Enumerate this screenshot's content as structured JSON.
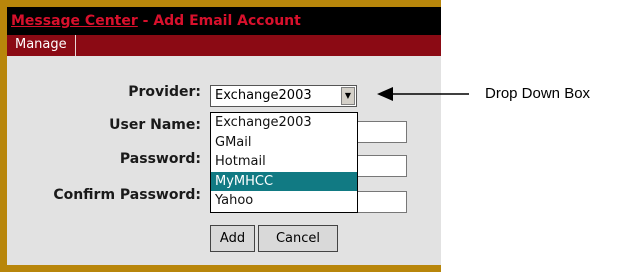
{
  "window": {
    "title_link": "Message Center",
    "title_rest": " - Add Email Account"
  },
  "menu": {
    "items": [
      {
        "label": "Manage"
      }
    ]
  },
  "form": {
    "provider_label": "Provider:",
    "username_label": "User Name:",
    "password_label": "Password:",
    "confirm_label": "Confirm Password:",
    "provider_selected": "Exchange2003",
    "provider_options": [
      "Exchange2003",
      "GMail",
      "Hotmail",
      "MyMHCC",
      "Yahoo"
    ],
    "highlighted_option": "MyMHCC",
    "username_value": "",
    "password_value": "",
    "confirm_value": ""
  },
  "buttons": {
    "add_label": "Add",
    "cancel_label": "Cancel"
  },
  "annotation": {
    "label": "Drop Down Box"
  },
  "colors": {
    "frame": "#b8860b",
    "titlebar_bg": "#000000",
    "title_text": "#d8102c",
    "menubar_bg": "#8b0a14",
    "panel_bg": "#e2e2e2",
    "highlight": "#117a83"
  }
}
